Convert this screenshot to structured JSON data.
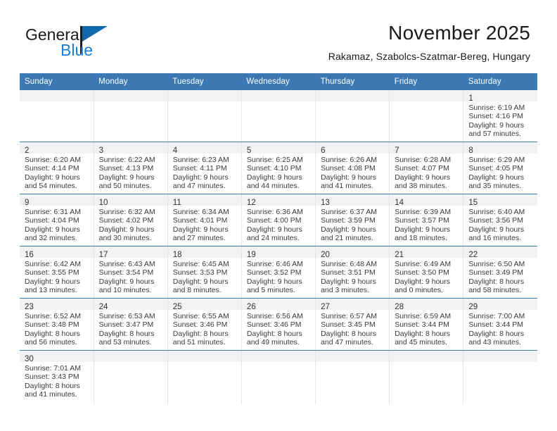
{
  "brand": {
    "name_part1": "General",
    "name_part2": "Blue",
    "logo_icon": "blue-flag-triangle"
  },
  "header": {
    "title": "November 2025",
    "subtitle": "Rakamaz, Szabolcs-Szatmar-Bereg, Hungary"
  },
  "colors": {
    "header_blue": "#3c79b4",
    "brand_blue": "#1a7fd4",
    "logo_flag_blue": "#1168ad",
    "daynum_band": "#f2f2f2",
    "cell_divider": "#e6e6e6",
    "row_divider": "#3c79b4",
    "text": "#3a3a3a"
  },
  "weekdays": [
    "Sunday",
    "Monday",
    "Tuesday",
    "Wednesday",
    "Thursday",
    "Friday",
    "Saturday"
  ],
  "labels": {
    "sunrise_prefix": "Sunrise:",
    "sunset_prefix": "Sunset:",
    "daylight_prefix": "Daylight:"
  },
  "weeks": [
    [
      {
        "empty": true
      },
      {
        "empty": true
      },
      {
        "empty": true
      },
      {
        "empty": true
      },
      {
        "empty": true
      },
      {
        "empty": true
      },
      {
        "day": "1",
        "l1": "Sunrise: 6:19 AM",
        "l2": "Sunset: 4:16 PM",
        "l3": "Daylight: 9 hours",
        "l4": "and 57 minutes."
      }
    ],
    [
      {
        "day": "2",
        "l1": "Sunrise: 6:20 AM",
        "l2": "Sunset: 4:14 PM",
        "l3": "Daylight: 9 hours",
        "l4": "and 54 minutes."
      },
      {
        "day": "3",
        "l1": "Sunrise: 6:22 AM",
        "l2": "Sunset: 4:13 PM",
        "l3": "Daylight: 9 hours",
        "l4": "and 50 minutes."
      },
      {
        "day": "4",
        "l1": "Sunrise: 6:23 AM",
        "l2": "Sunset: 4:11 PM",
        "l3": "Daylight: 9 hours",
        "l4": "and 47 minutes."
      },
      {
        "day": "5",
        "l1": "Sunrise: 6:25 AM",
        "l2": "Sunset: 4:10 PM",
        "l3": "Daylight: 9 hours",
        "l4": "and 44 minutes."
      },
      {
        "day": "6",
        "l1": "Sunrise: 6:26 AM",
        "l2": "Sunset: 4:08 PM",
        "l3": "Daylight: 9 hours",
        "l4": "and 41 minutes."
      },
      {
        "day": "7",
        "l1": "Sunrise: 6:28 AM",
        "l2": "Sunset: 4:07 PM",
        "l3": "Daylight: 9 hours",
        "l4": "and 38 minutes."
      },
      {
        "day": "8",
        "l1": "Sunrise: 6:29 AM",
        "l2": "Sunset: 4:05 PM",
        "l3": "Daylight: 9 hours",
        "l4": "and 35 minutes."
      }
    ],
    [
      {
        "day": "9",
        "l1": "Sunrise: 6:31 AM",
        "l2": "Sunset: 4:04 PM",
        "l3": "Daylight: 9 hours",
        "l4": "and 32 minutes."
      },
      {
        "day": "10",
        "l1": "Sunrise: 6:32 AM",
        "l2": "Sunset: 4:02 PM",
        "l3": "Daylight: 9 hours",
        "l4": "and 30 minutes."
      },
      {
        "day": "11",
        "l1": "Sunrise: 6:34 AM",
        "l2": "Sunset: 4:01 PM",
        "l3": "Daylight: 9 hours",
        "l4": "and 27 minutes."
      },
      {
        "day": "12",
        "l1": "Sunrise: 6:36 AM",
        "l2": "Sunset: 4:00 PM",
        "l3": "Daylight: 9 hours",
        "l4": "and 24 minutes."
      },
      {
        "day": "13",
        "l1": "Sunrise: 6:37 AM",
        "l2": "Sunset: 3:59 PM",
        "l3": "Daylight: 9 hours",
        "l4": "and 21 minutes."
      },
      {
        "day": "14",
        "l1": "Sunrise: 6:39 AM",
        "l2": "Sunset: 3:57 PM",
        "l3": "Daylight: 9 hours",
        "l4": "and 18 minutes."
      },
      {
        "day": "15",
        "l1": "Sunrise: 6:40 AM",
        "l2": "Sunset: 3:56 PM",
        "l3": "Daylight: 9 hours",
        "l4": "and 16 minutes."
      }
    ],
    [
      {
        "day": "16",
        "l1": "Sunrise: 6:42 AM",
        "l2": "Sunset: 3:55 PM",
        "l3": "Daylight: 9 hours",
        "l4": "and 13 minutes."
      },
      {
        "day": "17",
        "l1": "Sunrise: 6:43 AM",
        "l2": "Sunset: 3:54 PM",
        "l3": "Daylight: 9 hours",
        "l4": "and 10 minutes."
      },
      {
        "day": "18",
        "l1": "Sunrise: 6:45 AM",
        "l2": "Sunset: 3:53 PM",
        "l3": "Daylight: 9 hours",
        "l4": "and 8 minutes."
      },
      {
        "day": "19",
        "l1": "Sunrise: 6:46 AM",
        "l2": "Sunset: 3:52 PM",
        "l3": "Daylight: 9 hours",
        "l4": "and 5 minutes."
      },
      {
        "day": "20",
        "l1": "Sunrise: 6:48 AM",
        "l2": "Sunset: 3:51 PM",
        "l3": "Daylight: 9 hours",
        "l4": "and 3 minutes."
      },
      {
        "day": "21",
        "l1": "Sunrise: 6:49 AM",
        "l2": "Sunset: 3:50 PM",
        "l3": "Daylight: 9 hours",
        "l4": "and 0 minutes."
      },
      {
        "day": "22",
        "l1": "Sunrise: 6:50 AM",
        "l2": "Sunset: 3:49 PM",
        "l3": "Daylight: 8 hours",
        "l4": "and 58 minutes."
      }
    ],
    [
      {
        "day": "23",
        "l1": "Sunrise: 6:52 AM",
        "l2": "Sunset: 3:48 PM",
        "l3": "Daylight: 8 hours",
        "l4": "and 56 minutes."
      },
      {
        "day": "24",
        "l1": "Sunrise: 6:53 AM",
        "l2": "Sunset: 3:47 PM",
        "l3": "Daylight: 8 hours",
        "l4": "and 53 minutes."
      },
      {
        "day": "25",
        "l1": "Sunrise: 6:55 AM",
        "l2": "Sunset: 3:46 PM",
        "l3": "Daylight: 8 hours",
        "l4": "and 51 minutes."
      },
      {
        "day": "26",
        "l1": "Sunrise: 6:56 AM",
        "l2": "Sunset: 3:46 PM",
        "l3": "Daylight: 8 hours",
        "l4": "and 49 minutes."
      },
      {
        "day": "27",
        "l1": "Sunrise: 6:57 AM",
        "l2": "Sunset: 3:45 PM",
        "l3": "Daylight: 8 hours",
        "l4": "and 47 minutes."
      },
      {
        "day": "28",
        "l1": "Sunrise: 6:59 AM",
        "l2": "Sunset: 3:44 PM",
        "l3": "Daylight: 8 hours",
        "l4": "and 45 minutes."
      },
      {
        "day": "29",
        "l1": "Sunrise: 7:00 AM",
        "l2": "Sunset: 3:44 PM",
        "l3": "Daylight: 8 hours",
        "l4": "and 43 minutes."
      }
    ],
    [
      {
        "day": "30",
        "l1": "Sunrise: 7:01 AM",
        "l2": "Sunset: 3:43 PM",
        "l3": "Daylight: 8 hours",
        "l4": "and 41 minutes."
      },
      {
        "empty": true
      },
      {
        "empty": true
      },
      {
        "empty": true
      },
      {
        "empty": true
      },
      {
        "empty": true
      },
      {
        "empty": true
      }
    ]
  ]
}
